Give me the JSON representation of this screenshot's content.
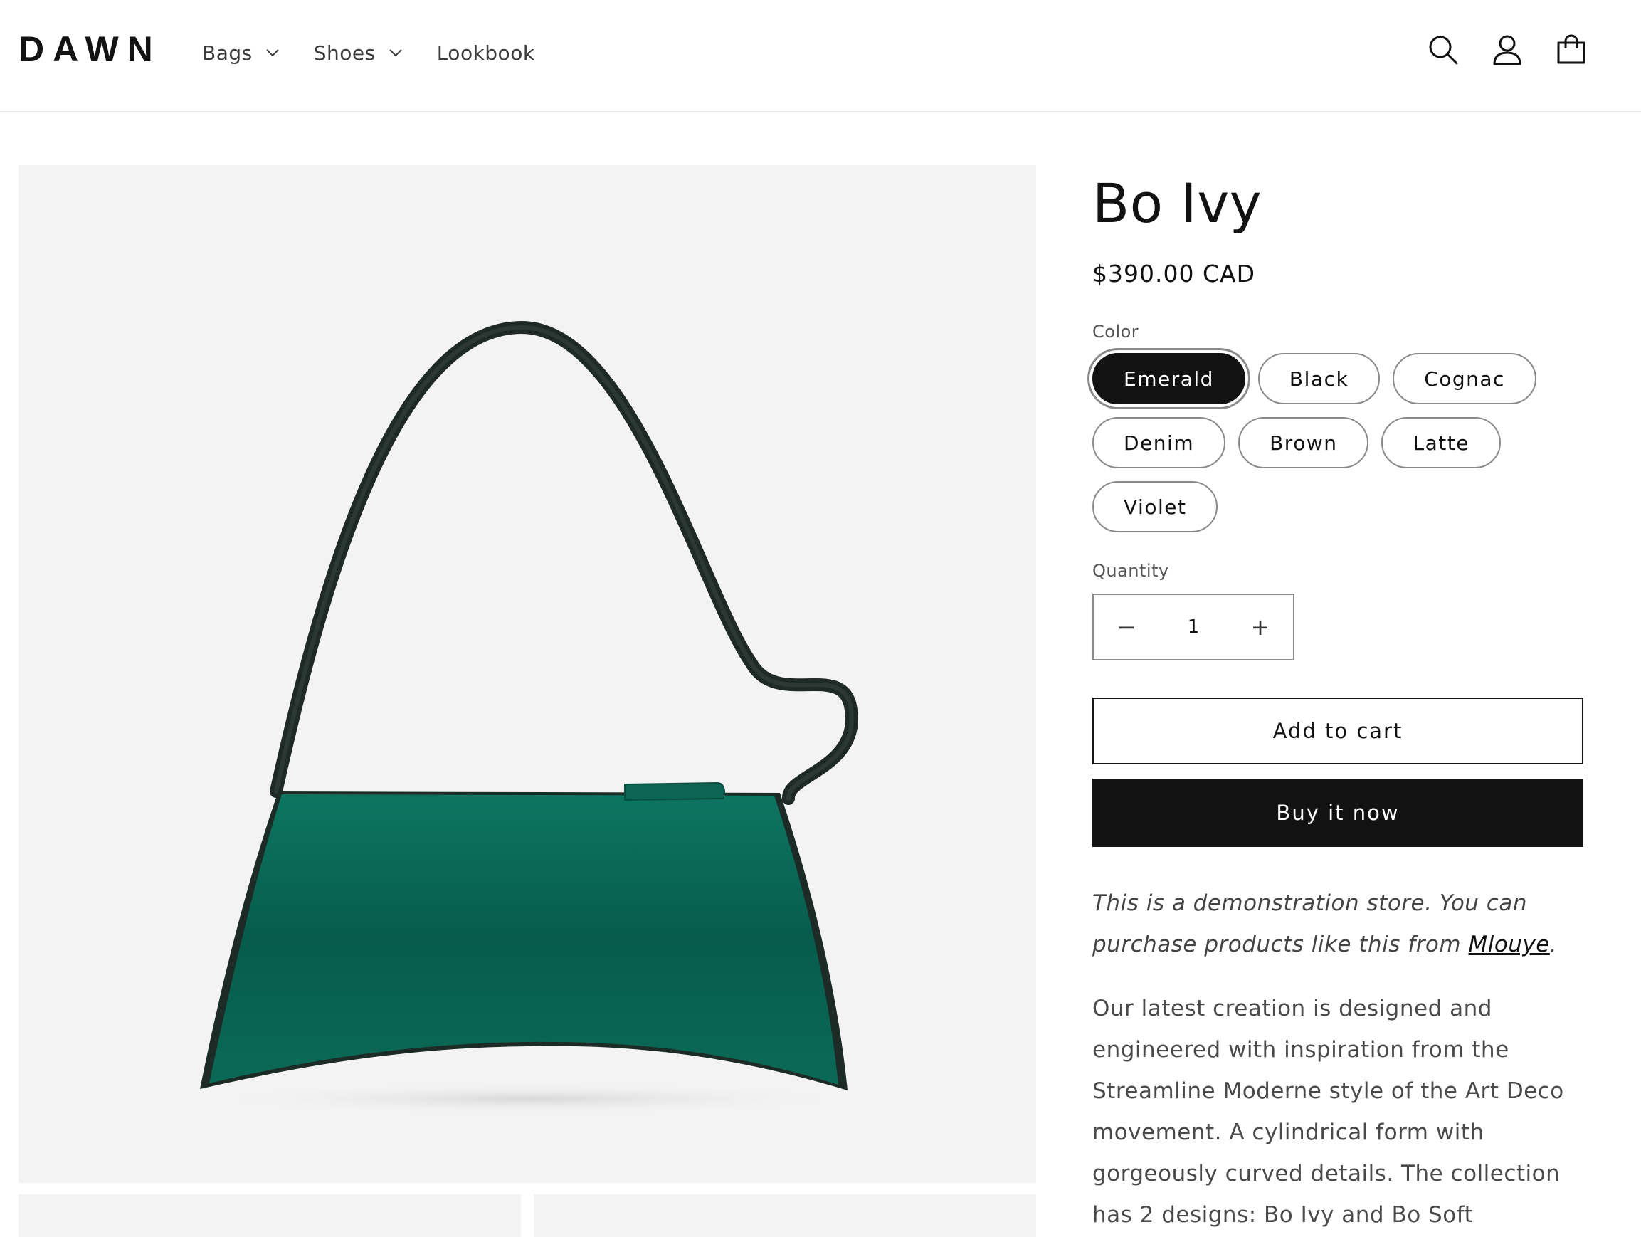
{
  "header": {
    "logo": "DAWN",
    "nav": [
      {
        "label": "Bags",
        "has_dropdown": true
      },
      {
        "label": "Shoes",
        "has_dropdown": true
      },
      {
        "label": "Lookbook",
        "has_dropdown": false
      }
    ],
    "icons": [
      "search-icon",
      "account-icon",
      "cart-icon"
    ]
  },
  "product": {
    "title": "Bo Ivy",
    "price": "$390.00 CAD",
    "color_label": "Color",
    "colors": [
      "Emerald",
      "Black",
      "Cognac",
      "Denim",
      "Brown",
      "Latte",
      "Violet"
    ],
    "selected_color": "Emerald",
    "quantity_label": "Quantity",
    "quantity": "1",
    "quantity_minus": "−",
    "quantity_plus": "+",
    "add_to_cart": "Add to cart",
    "buy_now": "Buy it now",
    "demo_text_before": "This is a demonstration store. You can purchase products like this from ",
    "demo_link": "Mlouye",
    "demo_text_after": ".",
    "description": "Our latest creation is designed and engineered with inspiration from the Streamline Moderne style of the Art Deco movement. A cylindrical form with gorgeously curved details. The collection has 2 designs: Bo Ivy and Bo Soft"
  },
  "colors": {
    "bag_green": "#0b6b57",
    "strap": "#1f2a26",
    "image_bg": "#f3f3f3",
    "primary": "#121212"
  }
}
